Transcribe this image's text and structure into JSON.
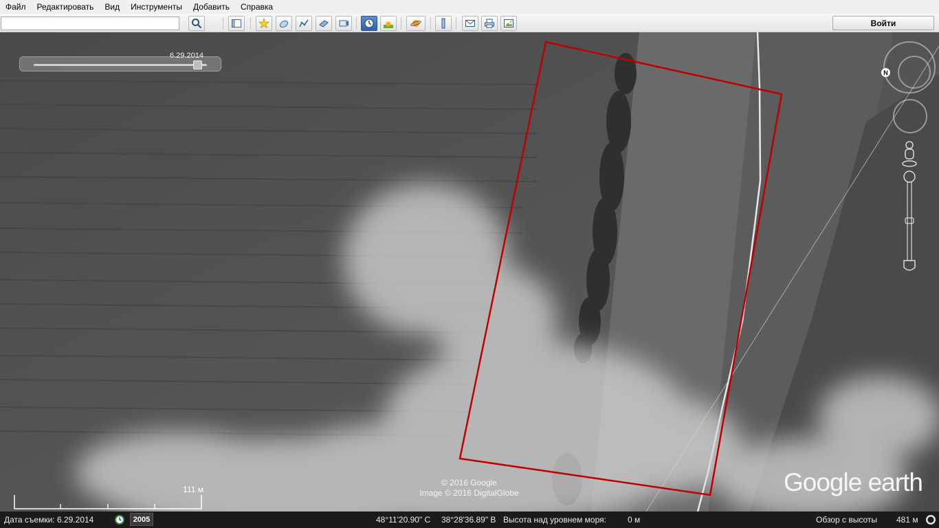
{
  "menu": [
    "Файл",
    "Редактировать",
    "Вид",
    "Инструменты",
    "Добавить",
    "Справка"
  ],
  "search": {
    "value": "",
    "placeholder": ""
  },
  "toolbar": {
    "login_label": "Войти"
  },
  "time_slider": {
    "date": "6.29.2014",
    "position_fraction": 0.95
  },
  "map": {
    "attribution_line1": "© 2016 Google",
    "attribution_line2": "Image © 2016 DigitalGlobe",
    "logo": "Google earth",
    "scale_label": "111 м",
    "north_label": "N",
    "outline_color": "#c00000"
  },
  "status": {
    "capture_date": "Дата съемки: 6.29.2014",
    "year": "2005",
    "lat": "48°11'20.90\" С",
    "lon": "38°28'36.89\" В",
    "elevation_label": "Высота над уровнем моря:",
    "elevation_value": "0 м",
    "eye_label": "Обзор с высоты",
    "eye_value": "481 м"
  }
}
